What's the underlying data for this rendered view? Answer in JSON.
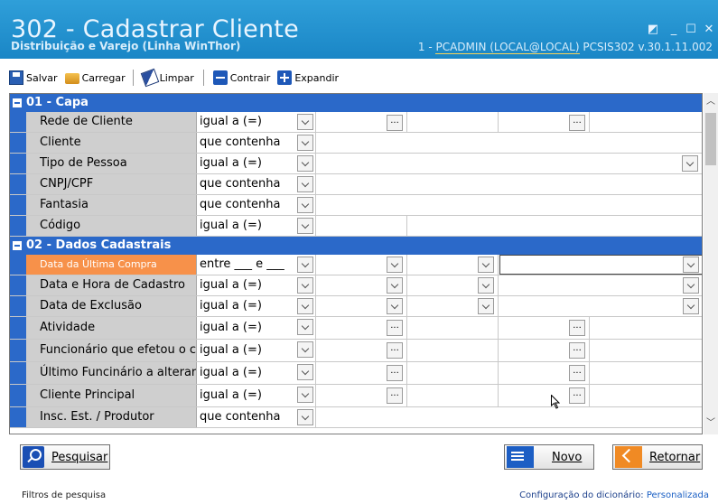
{
  "window": {
    "title": "302 - Cadastrar Cliente",
    "subtitle": "Distribuição e Varejo (Linha WinThor)",
    "userinfo_prefix": "1 - ",
    "userinfo_link": "PCADMIN (LOCAL@LOCAL)",
    "userinfo_suffix": "  PCSIS302  v.30.1.11.002"
  },
  "toolbar": {
    "save": "Salvar",
    "load": "Carregar",
    "clear": "Limpar",
    "collapse": "Contrair",
    "expand": "Expandir"
  },
  "sections": [
    {
      "title": "01 - Capa",
      "rows": [
        {
          "label": "Rede de Cliente",
          "op": "igual a (=)"
        },
        {
          "label": "Cliente",
          "op": "que contenha"
        },
        {
          "label": "Tipo de Pessoa",
          "op": "igual a (=)"
        },
        {
          "label": "CNPJ/CPF",
          "op": "que contenha"
        },
        {
          "label": "Fantasia",
          "op": "que contenha"
        },
        {
          "label": "Código",
          "op": "igual a (=)"
        }
      ]
    },
    {
      "title": "02 - Dados Cadastrais",
      "rows": [
        {
          "label": "Data da Última Compra",
          "op": "entre ___ e ___"
        },
        {
          "label": "Data e Hora de Cadastro",
          "op": "igual a (=)"
        },
        {
          "label": "Data de Exclusão",
          "op": "igual a (=)"
        },
        {
          "label": "Atividade",
          "op": "igual a (=)"
        },
        {
          "label": "Funcionário que efetou o ca",
          "op": "igual a (=)"
        },
        {
          "label": "Último Funcinário a alterar o",
          "op": "igual a (=)"
        },
        {
          "label": "Cliente Principal",
          "op": "igual a (=)"
        },
        {
          "label": "Insc. Est. / Produtor",
          "op": "que contenha"
        }
      ]
    }
  ],
  "buttons": {
    "search": "Pesquisar",
    "new": "Novo",
    "back": "Retornar"
  },
  "status": {
    "left": "Filtros de pesquisa",
    "right_label": "Configuração do dicionário: ",
    "right_value": "Personalizada"
  }
}
